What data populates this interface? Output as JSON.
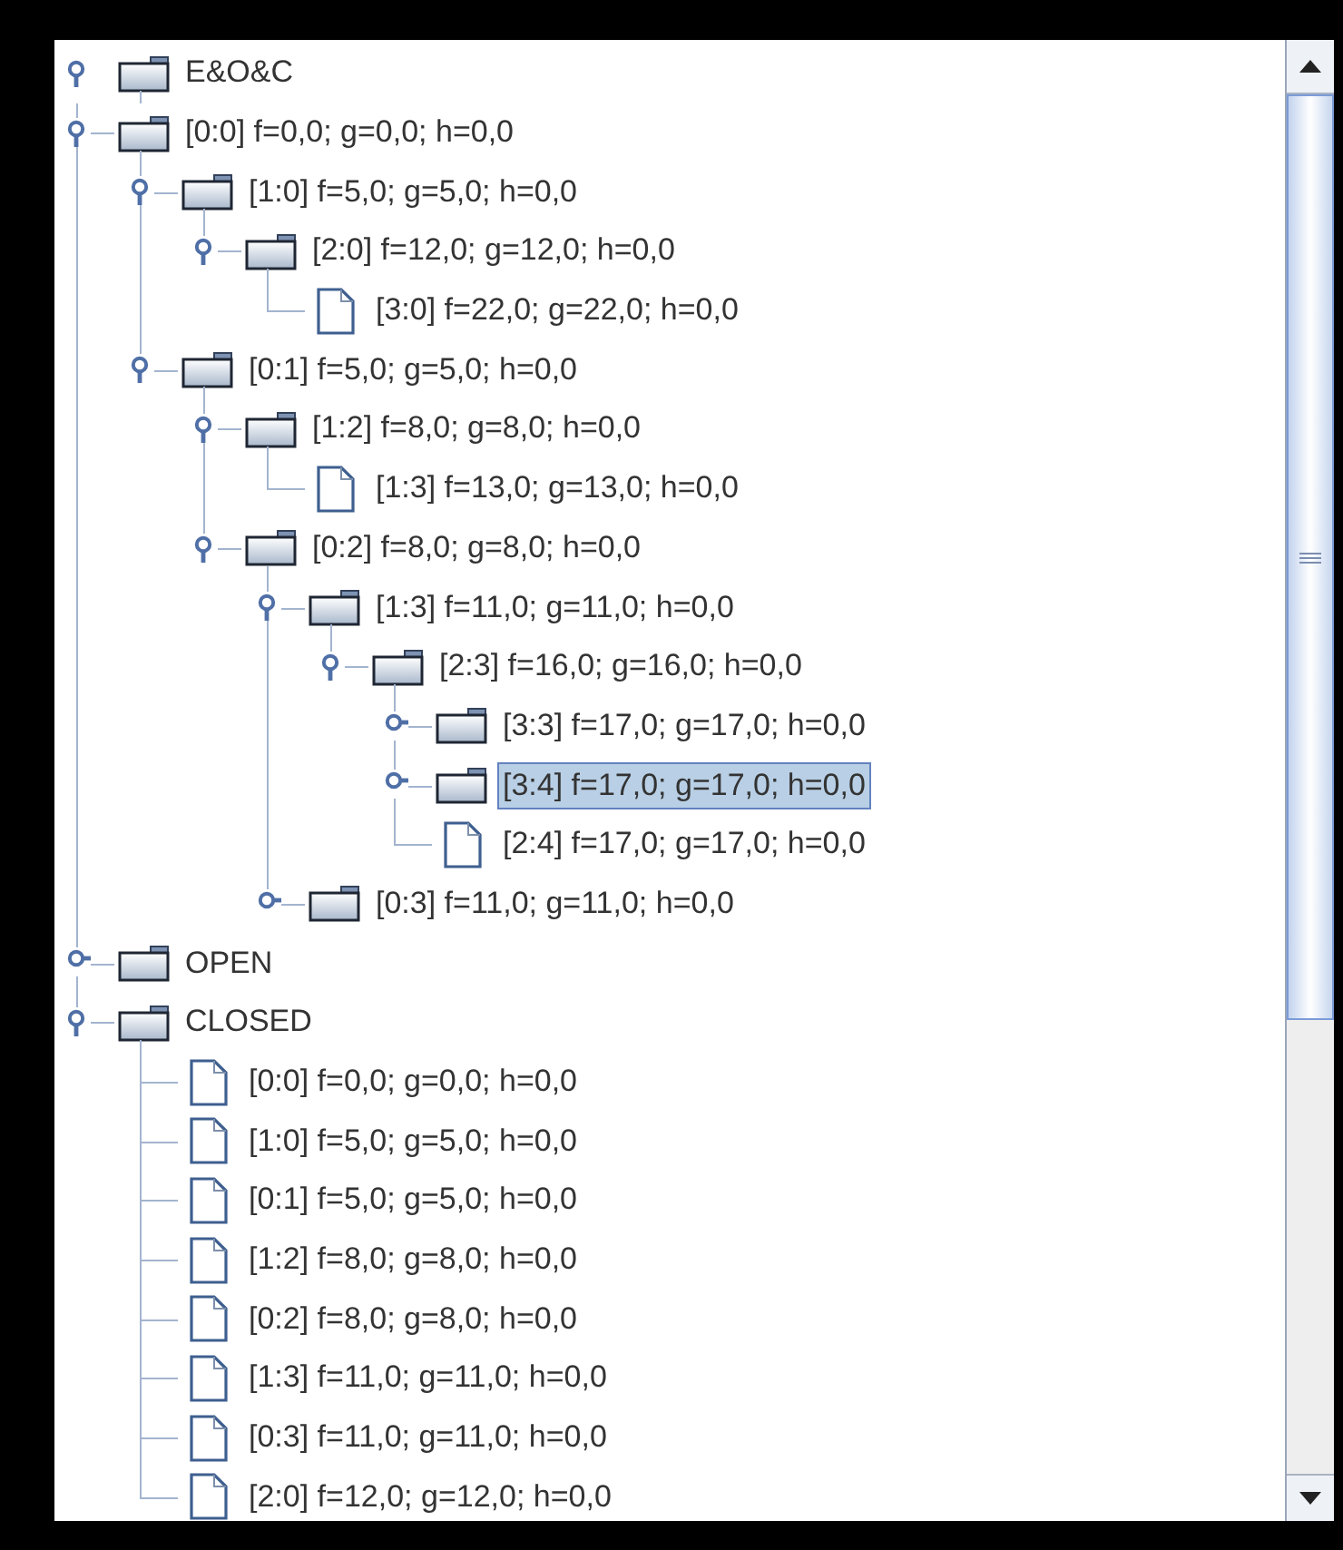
{
  "tree": {
    "label": "E&O&C",
    "kind": "folder",
    "expanded": true,
    "selected": false,
    "children": [
      {
        "label": "[0:0] f=0,0; g=0,0; h=0,0",
        "kind": "folder",
        "expanded": true,
        "selected": false,
        "children": [
          {
            "label": "[1:0] f=5,0; g=5,0; h=0,0",
            "kind": "folder",
            "expanded": true,
            "selected": false,
            "children": [
              {
                "label": "[2:0] f=12,0; g=12,0; h=0,0",
                "kind": "folder",
                "expanded": true,
                "selected": false,
                "children": [
                  {
                    "label": "[3:0] f=22,0; g=22,0; h=0,0",
                    "kind": "file",
                    "selected": false
                  }
                ]
              }
            ]
          },
          {
            "label": "[0:1] f=5,0; g=5,0; h=0,0",
            "kind": "folder",
            "expanded": true,
            "selected": false,
            "children": [
              {
                "label": "[1:2] f=8,0; g=8,0; h=0,0",
                "kind": "folder",
                "expanded": true,
                "selected": false,
                "children": [
                  {
                    "label": "[1:3] f=13,0; g=13,0; h=0,0",
                    "kind": "file",
                    "selected": false
                  }
                ]
              },
              {
                "label": "[0:2] f=8,0; g=8,0; h=0,0",
                "kind": "folder",
                "expanded": true,
                "selected": false,
                "children": [
                  {
                    "label": "[1:3] f=11,0; g=11,0; h=0,0",
                    "kind": "folder",
                    "expanded": true,
                    "selected": false,
                    "children": [
                      {
                        "label": "[2:3] f=16,0; g=16,0; h=0,0",
                        "kind": "folder",
                        "expanded": true,
                        "selected": false,
                        "children": [
                          {
                            "label": "[3:3] f=17,0; g=17,0; h=0,0",
                            "kind": "folder",
                            "expanded": false,
                            "selected": false
                          },
                          {
                            "label": "[3:4] f=17,0; g=17,0; h=0,0",
                            "kind": "folder",
                            "expanded": false,
                            "selected": true
                          },
                          {
                            "label": "[2:4] f=17,0; g=17,0; h=0,0",
                            "kind": "file",
                            "selected": false
                          }
                        ]
                      }
                    ]
                  },
                  {
                    "label": "[0:3] f=11,0; g=11,0; h=0,0",
                    "kind": "folder",
                    "expanded": false,
                    "selected": false
                  }
                ]
              }
            ]
          }
        ]
      },
      {
        "label": "OPEN",
        "kind": "folder",
        "expanded": false,
        "selected": false
      },
      {
        "label": "CLOSED",
        "kind": "folder",
        "expanded": true,
        "selected": false,
        "children": [
          {
            "label": "[0:0] f=0,0; g=0,0; h=0,0",
            "kind": "file",
            "selected": false
          },
          {
            "label": "[1:0] f=5,0; g=5,0; h=0,0",
            "kind": "file",
            "selected": false
          },
          {
            "label": "[0:1] f=5,0; g=5,0; h=0,0",
            "kind": "file",
            "selected": false
          },
          {
            "label": "[1:2] f=8,0; g=8,0; h=0,0",
            "kind": "file",
            "selected": false
          },
          {
            "label": "[0:2] f=8,0; g=8,0; h=0,0",
            "kind": "file",
            "selected": false
          },
          {
            "label": "[1:3] f=11,0; g=11,0; h=0,0",
            "kind": "file",
            "selected": false
          },
          {
            "label": "[0:3] f=11,0; g=11,0; h=0,0",
            "kind": "file",
            "selected": false
          },
          {
            "label": "[2:0] f=12,0; g=12,0; h=0,0",
            "kind": "file",
            "selected": false
          }
        ]
      }
    ]
  }
}
